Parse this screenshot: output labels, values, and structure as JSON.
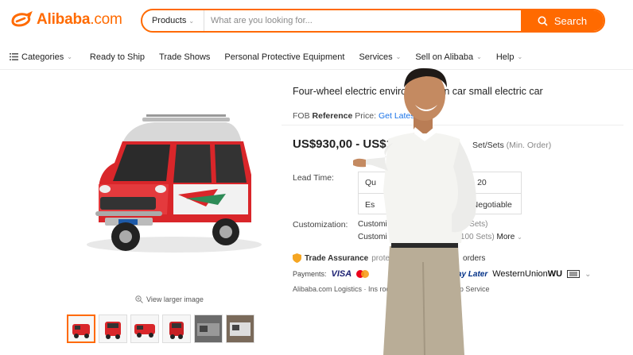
{
  "header": {
    "logo_text": "Alibaba",
    "logo_suffix": ".com",
    "brand_color": "#ff6a00",
    "search": {
      "category": "Products",
      "placeholder": "What are you looking for...",
      "button_label": "Search"
    }
  },
  "nav": {
    "categories": "Categories",
    "items": [
      "Ready to Ship",
      "Trade Shows",
      "Personal Protective Equipment",
      "Services",
      "Sell on Alibaba",
      "Help"
    ]
  },
  "product": {
    "title": "Four-wheel electric environme  ction car small electric car",
    "fob_prefix": "FOB",
    "fob_ref": "Reference",
    "fob_price_label": "Price:",
    "fob_link": "Get Latest Pri",
    "price": "US$930,00 - US$1",
    "moq_unit": "Set/Sets",
    "moq_note": "(Min. Order)",
    "view_larger": "View larger image",
    "lead_time_label": "Lead Time:",
    "lead_time": {
      "row1_col1": "Qu",
      "row1_col2": "- 20",
      "row2_col1": "Es",
      "row2_col2": "Negotiable"
    },
    "customization_label": "Customization:",
    "customization_1_a": "Customi",
    "customization_1_b": "der: 100 Sets)",
    "customization_2_a": "Customi",
    "customization_2_b": "n. Order: 100 Sets)",
    "more": "More",
    "trade_assurance": "Trade Assurance",
    "trade_assurance_a": "prote",
    "trade_assurance_b": "orders",
    "payments_label": "Payments:",
    "payment_visa": "VISA",
    "payment_pay_later": "Pay Later",
    "payment_wu": "WesternUnion",
    "payment_wu_b": "WU",
    "services": "Alibaba.com Logistics  ·  Ins          roduction View  ·  One-Stop Service"
  }
}
